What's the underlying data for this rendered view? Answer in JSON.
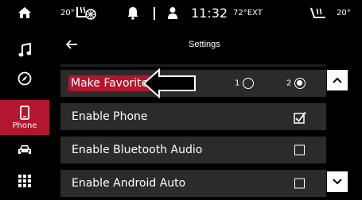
{
  "status_bar": {
    "left_temp": "20°",
    "time": "11:32",
    "ext_temp": "72°EXT",
    "right_temp": "20°"
  },
  "nav": {
    "items": [
      {
        "icon": "home-icon"
      },
      {
        "icon": "music-note-icon"
      },
      {
        "icon": "compass-icon"
      },
      {
        "icon": "phone-icon",
        "label": "Phone"
      },
      {
        "icon": "car-icon"
      },
      {
        "icon": "apps-grid-icon"
      }
    ]
  },
  "header": {
    "back_icon": "back-arrow-icon",
    "title": "Settings"
  },
  "rows": [
    {
      "label": "Make Favorite",
      "options": [
        "1",
        "2"
      ],
      "selected": "2"
    },
    {
      "label": "Enable Phone",
      "checked": true
    },
    {
      "label": "Enable Bluetooth Audio",
      "checked": false
    },
    {
      "label": "Enable Android Auto",
      "checked": false
    }
  ],
  "colors": {
    "accent": "#b3162e",
    "row_bg": "#2b2b2b",
    "background": "#000000"
  }
}
